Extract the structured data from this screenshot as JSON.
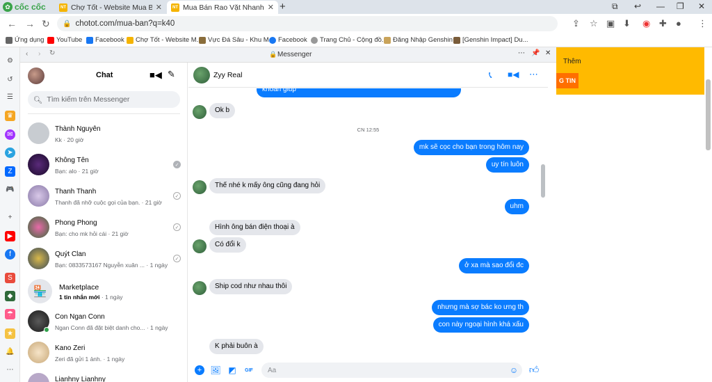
{
  "browser": {
    "brand": "cốc cốc",
    "tabs": [
      {
        "title": "Chợ Tốt - Website Mua Bán,",
        "active": false
      },
      {
        "title": "Mua Bán Rao Vặt Nhanh Chó",
        "active": true
      }
    ],
    "url": "chotot.com/mua-ban?q=k40",
    "bookmarks": [
      "Ứng dụng",
      "YouTube",
      "Facebook",
      "Chợ Tốt - Website M...",
      "Vực Đá Sâu - Khu M...",
      "Facebook",
      "Trang Chủ - Cộng đồ...",
      "Đăng Nhập Genshin...",
      "[Genshin Impact] Du..."
    ]
  },
  "messenger": {
    "window_title": "Messenger",
    "chat_list_title": "Chat",
    "search_placeholder": "Tìm kiếm trên Messenger",
    "conversations": [
      {
        "name": "Thành Nguyên",
        "preview": "Kk · 20 giờ"
      },
      {
        "name": "Không Tên",
        "preview": "Bạn: alo · 21 giờ"
      },
      {
        "name": "Thanh Thanh",
        "preview": "Thanh đã nhỡ cuộc gọi của bạn. · 21 giờ"
      },
      {
        "name": "Phong Phong",
        "preview": "Bạn: cho mk hỏi cái · 21 giờ"
      },
      {
        "name": "Quýt Clan",
        "preview": "Bạn: 0833573167 Nguyễn xuân ... · 1 ngày"
      },
      {
        "name": "Marketplace",
        "preview_bold": "1 tin nhắn mới",
        "preview": " · 1 ngày"
      },
      {
        "name": "Con Ngan Conn",
        "preview": "Ngan Conn đã đặt biệt danh cho... · 1 ngày"
      },
      {
        "name": "Kano Zeri",
        "preview": "Zeri đã gửi 1 ảnh. · 1 ngày"
      },
      {
        "name": "Lianhny Lianhny",
        "preview": ""
      }
    ],
    "chat_name": "Zyy Real",
    "timestamp": "CN 12:55",
    "messages": [
      {
        "text": "khoản giúp",
        "dir": "out"
      },
      {
        "text": "Ok b",
        "dir": "in"
      },
      {
        "text": "mk sẽ cọc cho bạn trong hôm nay",
        "dir": "out"
      },
      {
        "text": "uy tín luôn",
        "dir": "out"
      },
      {
        "text": "Thế nhé k mấy ông cũng đang hỏi",
        "dir": "in"
      },
      {
        "text": "uhm",
        "dir": "out"
      },
      {
        "text": "Hình ông bán điện thoại à",
        "dir": "in"
      },
      {
        "text": "Có đổi k",
        "dir": "in"
      },
      {
        "text": "ở xa mà sao đổi đc",
        "dir": "out"
      },
      {
        "text": "Ship cod như nhau thôi",
        "dir": "in"
      },
      {
        "text": "nhưng mà sợ bác ko ưng th",
        "dir": "out"
      },
      {
        "text": "con này ngoại hình khá xấu",
        "dir": "out"
      },
      {
        "text": "K phải buôn à",
        "dir": "in"
      }
    ],
    "composer_placeholder": "Aa"
  },
  "page_right": {
    "more_label": "Thêm",
    "button_label": "G TIN",
    "accent": "#ffba00"
  },
  "colors": {
    "messenger_blue": "#0a7cff",
    "incoming_bubble": "#e4e6eb"
  }
}
